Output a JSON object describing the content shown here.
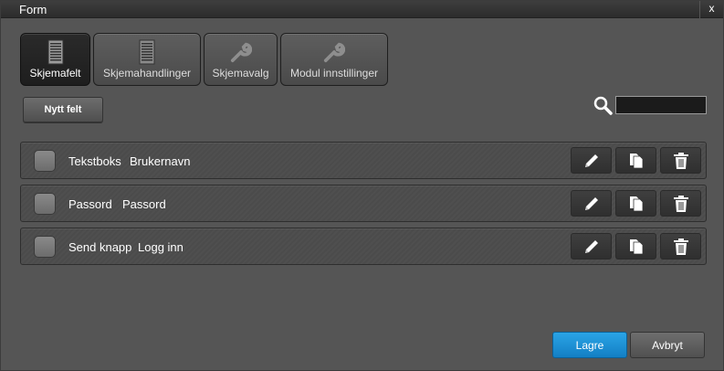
{
  "window": {
    "title": "Form",
    "close_label": "x"
  },
  "tabs": [
    {
      "label": "Skjemafelt",
      "icon": "list-icon",
      "active": true
    },
    {
      "label": "Skjemahandlinger",
      "icon": "list-icon",
      "active": false
    },
    {
      "label": "Skjemavalg",
      "icon": "wrench-icon",
      "active": false
    },
    {
      "label": "Modul innstillinger",
      "icon": "wrench-icon",
      "active": false
    }
  ],
  "toolbar": {
    "new_field_label": "Nytt felt",
    "search_value": ""
  },
  "fields": [
    {
      "type": "Tekstboks",
      "name": "Brukernavn"
    },
    {
      "type": "Passord",
      "name": "Passord"
    },
    {
      "type": "Send knapp",
      "name": "Logg inn"
    }
  ],
  "footer": {
    "save_label": "Lagre",
    "cancel_label": "Avbryt"
  },
  "colors": {
    "accent": "#1a8fd6",
    "background": "#555555"
  }
}
